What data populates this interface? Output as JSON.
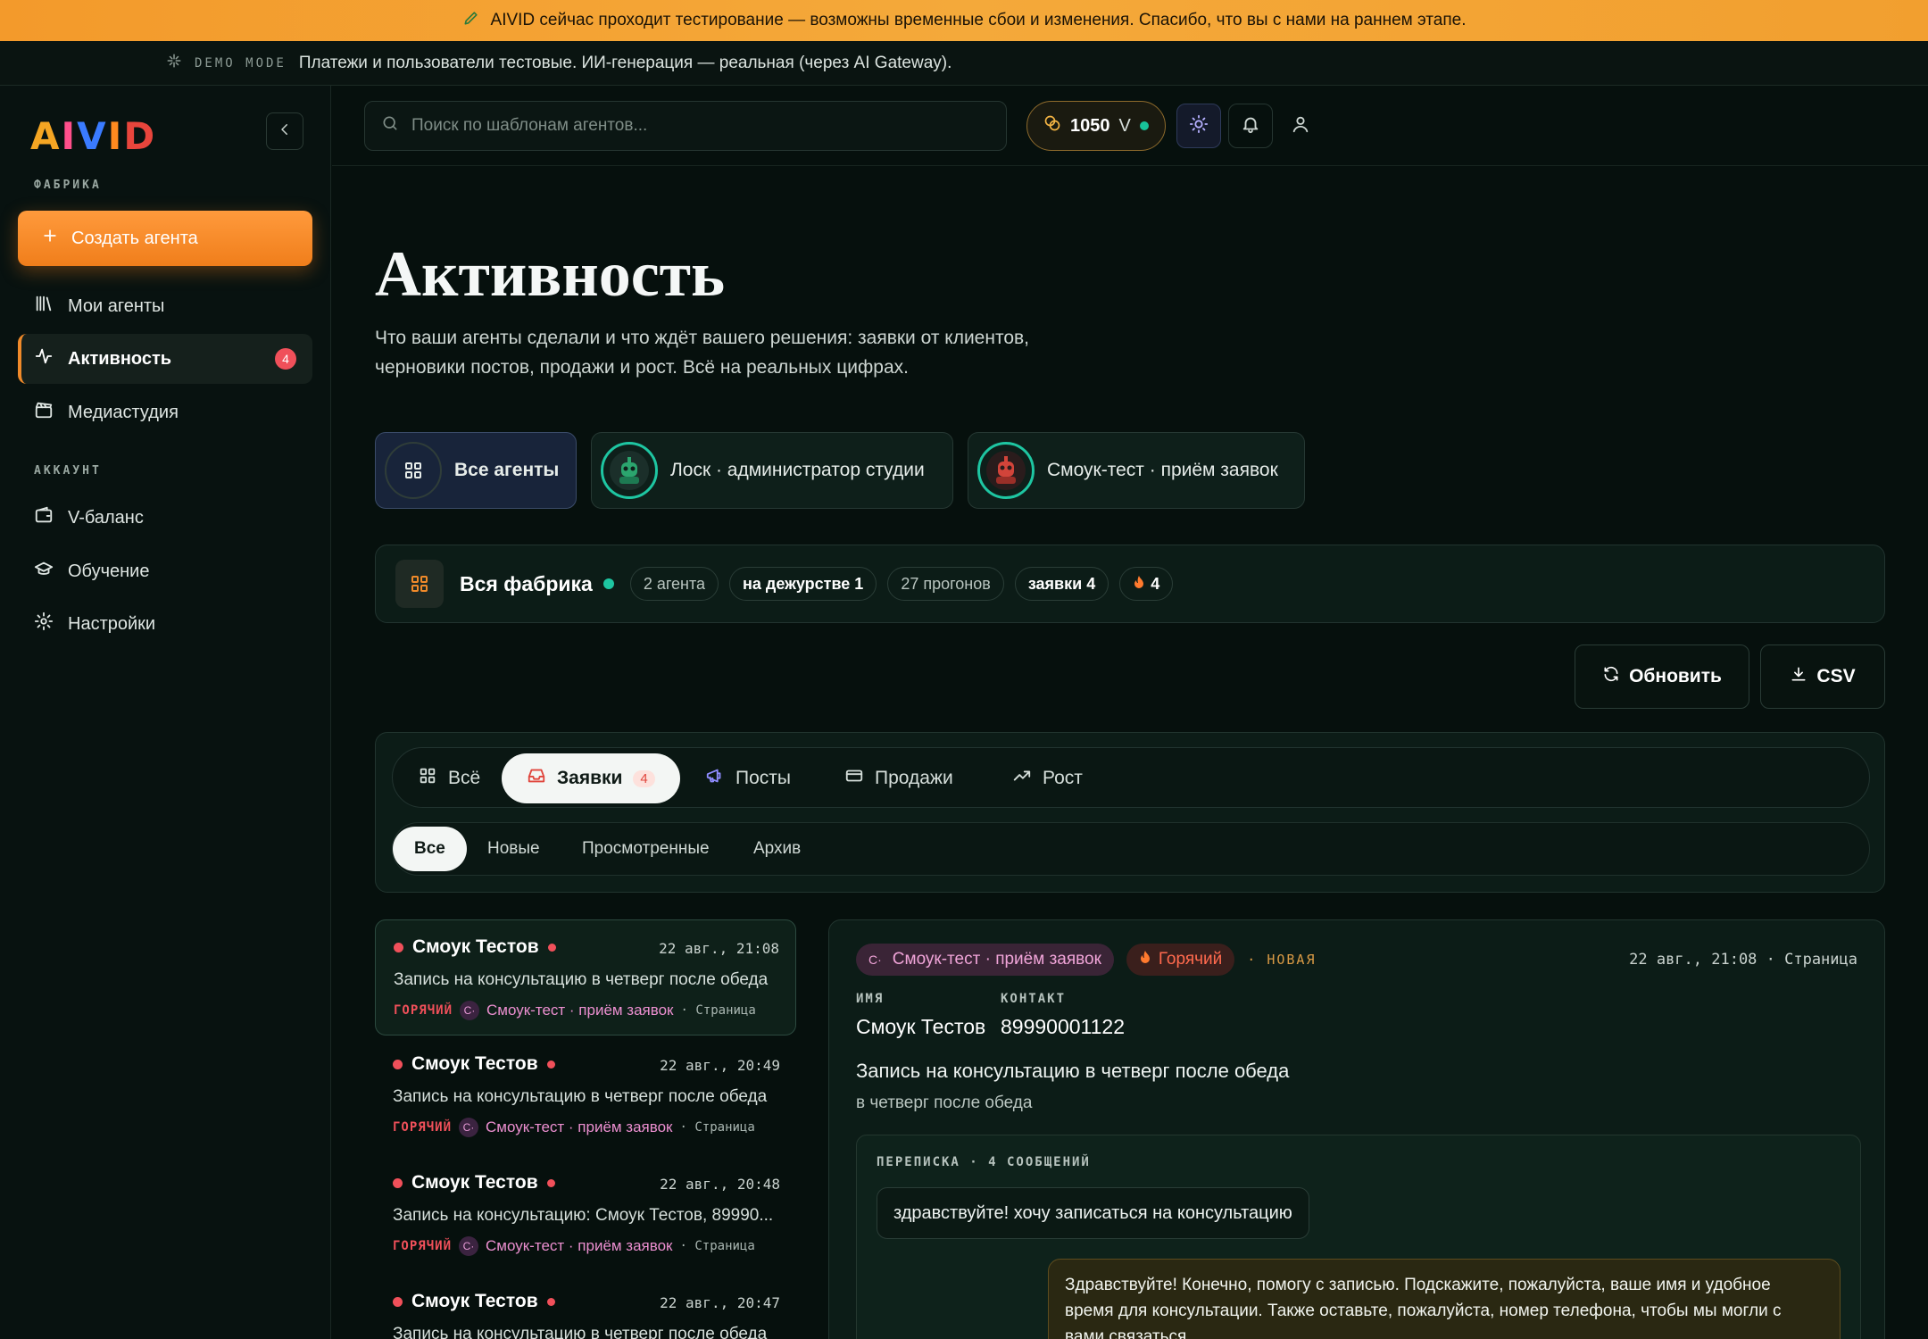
{
  "banner": {
    "text": "AIVID сейчас проходит тестирование — возможны временные сбои и изменения. Спасибо, что вы с нами на раннем этапе."
  },
  "demo": {
    "tag": "DEMO MODE",
    "text": "Платежи и пользователи тестовые. ИИ-генерация — реальная (через AI Gateway)."
  },
  "logo": {
    "letters": [
      "A",
      "I",
      "V",
      "I",
      "D"
    ],
    "colors": [
      "#f5a623",
      "#ff4f8b",
      "#3a7bff",
      "#ff8a1f",
      "#e8453c"
    ]
  },
  "sidebar": {
    "section_factory": "ФАБРИКА",
    "create_label": "Создать агента",
    "items": [
      {
        "label": "Мои агенты"
      },
      {
        "label": "Активность",
        "badge": "4"
      },
      {
        "label": "Медиастудия"
      }
    ],
    "section_account": "АККАУНТ",
    "account_items": [
      {
        "label": "V-баланс"
      },
      {
        "label": "Обучение"
      },
      {
        "label": "Настройки"
      }
    ]
  },
  "header": {
    "search_placeholder": "Поиск по шаблонам агентов...",
    "balance": "1050",
    "balance_unit": "V"
  },
  "page": {
    "title": "Активность",
    "subtitle": "Что ваши агенты сделали и что ждёт вашего решения: заявки от клиентов, черновики постов, продажи и рост. Всё на реальных цифрах."
  },
  "agents": [
    {
      "label": "Все агенты"
    },
    {
      "label": "Лоск · администратор студии"
    },
    {
      "label": "Смоук-тест · приём заявок"
    }
  ],
  "factory": {
    "title": "Вся фабрика",
    "chips": [
      "2 агента",
      "на дежурстве 1",
      "27 прогонов",
      "заявки 4",
      "4"
    ]
  },
  "actions": {
    "refresh": "Обновить",
    "csv": "CSV"
  },
  "tabs": [
    {
      "label": "Всё"
    },
    {
      "label": "Заявки",
      "count": "4"
    },
    {
      "label": "Посты"
    },
    {
      "label": "Продажи"
    },
    {
      "label": "Рост"
    }
  ],
  "subtabs": [
    "Все",
    "Новые",
    "Просмотренные",
    "Архив"
  ],
  "leads": [
    {
      "name": "Смоук Тестов",
      "time": "22 авг., 21:08",
      "text": "Запись на консультацию в четверг после обеда",
      "hot": "ГОРЯЧИЙ",
      "agent_initial": "С·",
      "agent": "Смоук-тест · приём заявок",
      "source": "· Страница"
    },
    {
      "name": "Смоук Тестов",
      "time": "22 авг., 20:49",
      "text": "Запись на консультацию в четверг после обеда",
      "hot": "ГОРЯЧИЙ",
      "agent_initial": "С·",
      "agent": "Смоук-тест · приём заявок",
      "source": "· Страница"
    },
    {
      "name": "Смоук Тестов",
      "time": "22 авг., 20:48",
      "text": "Запись на консультацию: Смоук Тестов, 89990...",
      "hot": "ГОРЯЧИЙ",
      "agent_initial": "С·",
      "agent": "Смоук-тест · приём заявок",
      "source": "· Страница"
    },
    {
      "name": "Смоук Тестов",
      "time": "22 авг., 20:47",
      "text": "Запись на консультацию в четверг после обеда",
      "hot": "",
      "agent_initial": "",
      "agent": "",
      "source": ""
    }
  ],
  "detail": {
    "agent_initial": "С·",
    "agent": "Смоук-тест · приём заявок",
    "hot": "Горячий",
    "status": "· НОВАЯ",
    "meta": "22 авг., 21:08 · Страница",
    "name_label": "ИМЯ",
    "name": "Смоук Тестов",
    "contact_label": "КОНТАКТ",
    "contact": "89990001122",
    "title": "Запись на консультацию в четверг после обеда",
    "subtitle": "в четверг после обеда",
    "conversation_label": "ПЕРЕПИСКА · 4 СООБЩЕНИЙ",
    "messages": [
      {
        "text": "здравствуйте! хочу записаться на консультацию"
      },
      {
        "text": "Здравствуйте! Конечно, помогу с записью. Подскажите, пожалуйста, ваше имя и удобное время для консультации. Также оставьте, пожалуйста, номер телефона, чтобы мы могли с вами связаться."
      }
    ]
  }
}
